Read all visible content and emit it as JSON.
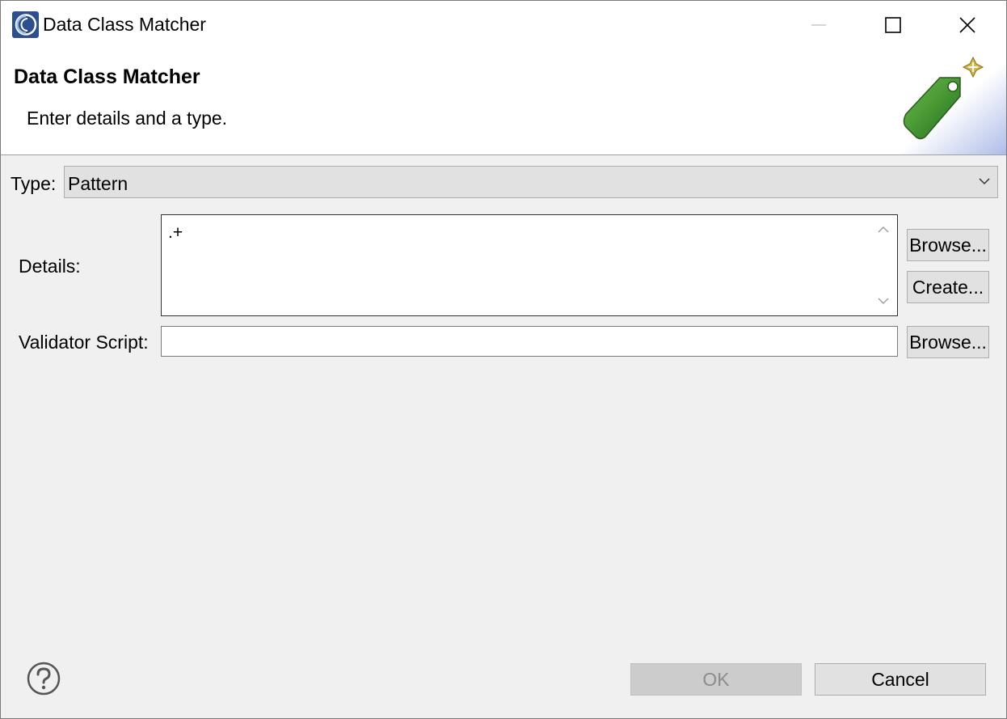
{
  "window": {
    "title": "Data Class Matcher",
    "app_icon": "eclipse-app-icon",
    "controls": {
      "minimize": "minimize-icon",
      "maximize": "maximize-icon",
      "close": "close-icon"
    }
  },
  "banner": {
    "title": "Data Class Matcher",
    "message": "Enter details and a type.",
    "image_icon": "price-tag-icon"
  },
  "form": {
    "type_label": "Type:",
    "type_value": "Pattern",
    "details_label": "Details:",
    "details_value": ".+",
    "validator_label": "Validator Script:",
    "validator_value": "",
    "browse_label": "Browse...",
    "create_label": "Create...",
    "browse2_label": "Browse..."
  },
  "footer": {
    "help_icon": "help-icon",
    "ok_label": "OK",
    "ok_enabled": false,
    "cancel_label": "Cancel"
  },
  "colors": {
    "dialog_bg": "#f0f0f0",
    "button_bg": "#e1e1e1",
    "disabled_text": "#8d8d8d",
    "tag_green": "#3f8f2f"
  }
}
